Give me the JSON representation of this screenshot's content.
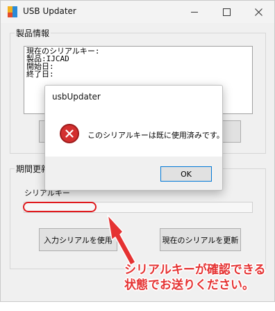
{
  "window": {
    "title": "USB Updater",
    "controls": {
      "minimize": "—",
      "maximize": "☐",
      "close": "✕"
    }
  },
  "product_info": {
    "group_label": "製品情報",
    "lines": [
      "現在のシリアルキー:",
      "製品:IJCAD",
      "開始日:",
      "終了日:"
    ]
  },
  "period": {
    "group_label": "期間更新",
    "serial_label": "シリアルキー",
    "serial_value": "",
    "use_input_button": "入力シリアルを使用",
    "update_current_button": "現在のシリアルを更新"
  },
  "dialog": {
    "title": "usbUpdater",
    "message": "このシリアルキーは既に使用済みです。",
    "ok_label": "OK",
    "icon": "error-icon"
  },
  "annotation": {
    "line1": "シリアルキーが確認できる",
    "line2": "状態でお送りください。",
    "color": "#e53232"
  }
}
